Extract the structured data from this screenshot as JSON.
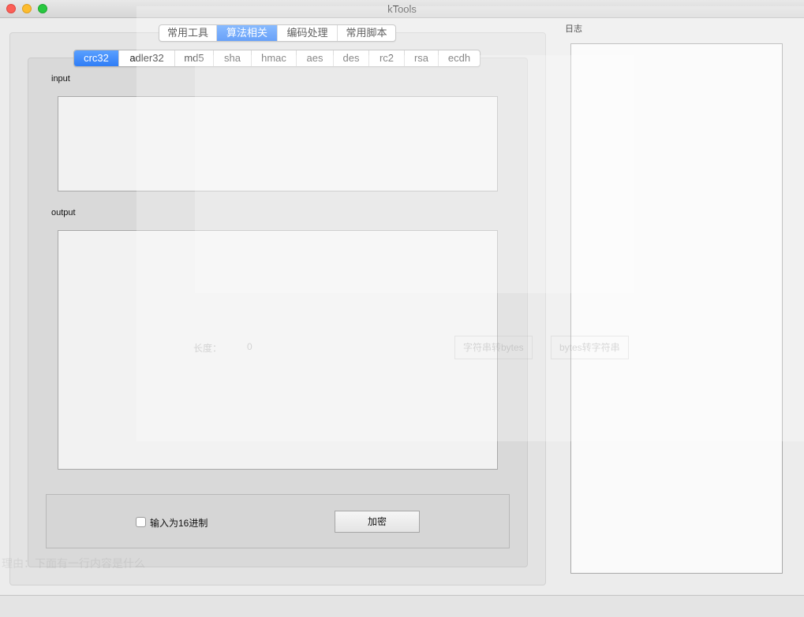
{
  "window": {
    "title": "kTools"
  },
  "top_tabs": [
    {
      "label": "常用工具",
      "active": false
    },
    {
      "label": "算法相关",
      "active": true
    },
    {
      "label": "编码处理",
      "active": false
    },
    {
      "label": "常用脚本",
      "active": false
    }
  ],
  "algo_tabs": [
    {
      "label": "crc32",
      "active": true
    },
    {
      "label": "adler32",
      "active": false
    },
    {
      "label": "md5",
      "active": false
    },
    {
      "label": "sha",
      "active": false
    },
    {
      "label": "hmac",
      "active": false
    },
    {
      "label": "aes",
      "active": false
    },
    {
      "label": "des",
      "active": false
    },
    {
      "label": "rc2",
      "active": false
    },
    {
      "label": "rsa",
      "active": false
    },
    {
      "label": "ecdh",
      "active": false
    }
  ],
  "input": {
    "label": "input",
    "value": ""
  },
  "output": {
    "label": "output",
    "value": ""
  },
  "controls": {
    "hex_checkbox_label": "输入为16进制",
    "hex_checked": false,
    "encrypt_button": "加密"
  },
  "log": {
    "label": "日志",
    "value": ""
  },
  "ghost": {
    "length_label": "长度：",
    "length_value": "0",
    "btn_str_to_bytes": "字符串转bytes",
    "btn_bytes_to_str": "bytes转字符串",
    "bottom_text": "理由：下面有一行内容是什么"
  },
  "colors": {
    "accent": "#2f7df6",
    "close": "#fc5f57",
    "minimize": "#fdbc2e",
    "maximize": "#28c840"
  }
}
